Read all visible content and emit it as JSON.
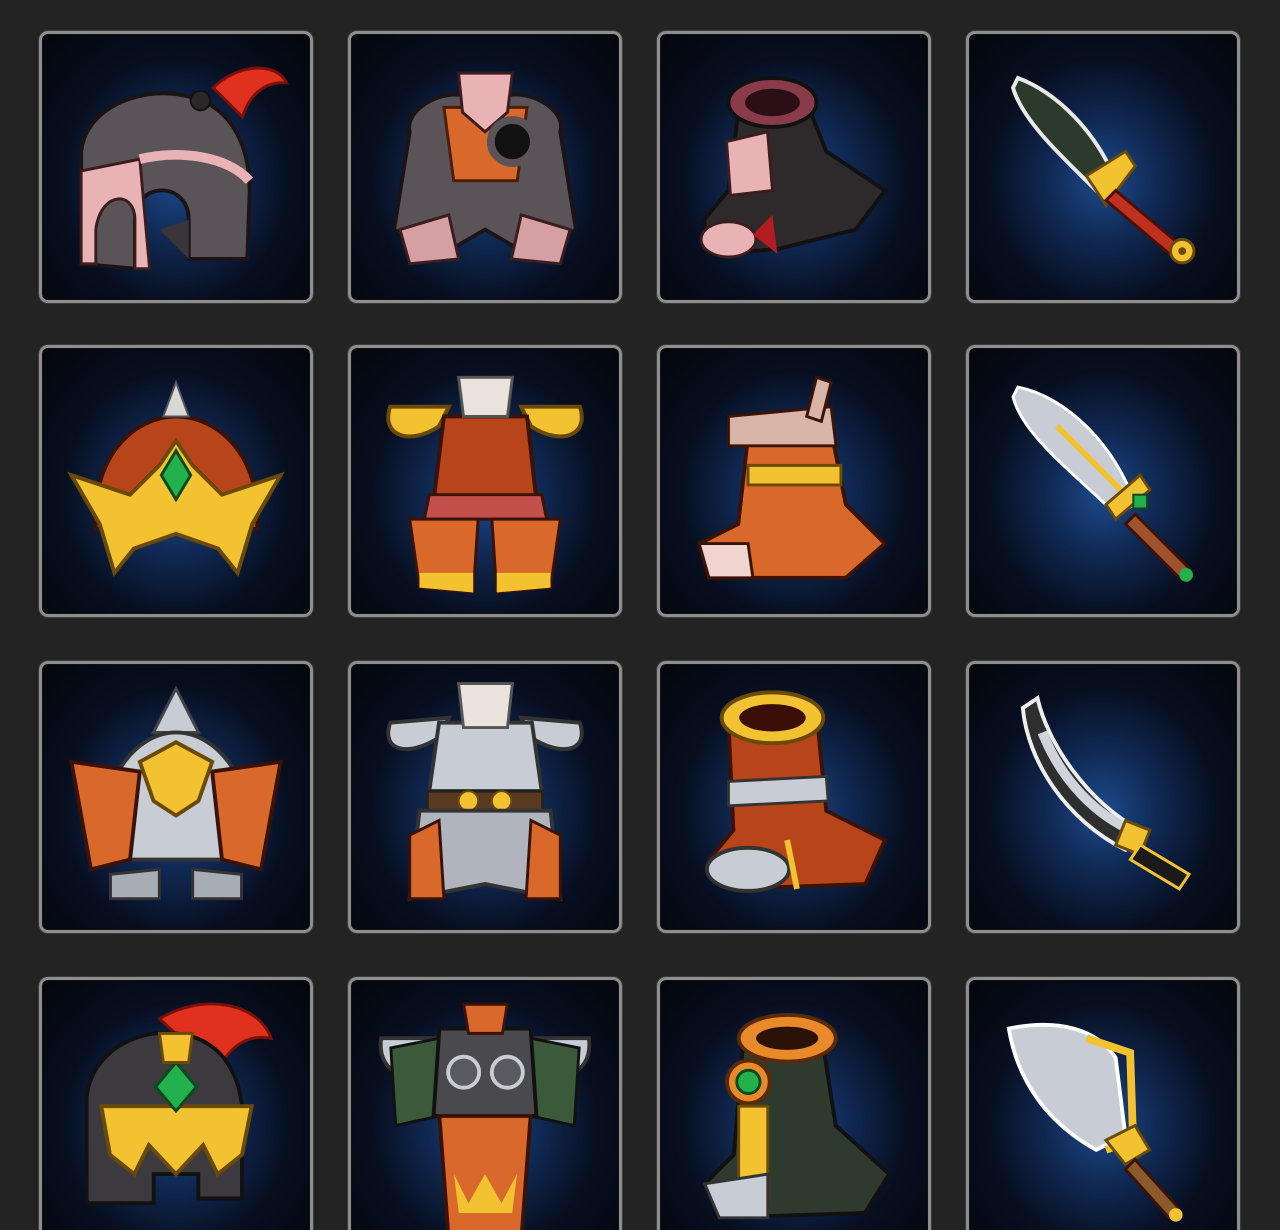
{
  "inventory": {
    "rows": 4,
    "columns": 4,
    "slots": [
      {
        "icon": "iron-plumed-helmet-icon",
        "type": "helmet",
        "row": 1,
        "col": 1
      },
      {
        "icon": "iron-chest-armor-icon",
        "type": "armor",
        "row": 1,
        "col": 2
      },
      {
        "icon": "iron-boot-icon",
        "type": "boots",
        "row": 1,
        "col": 3
      },
      {
        "icon": "gold-hilt-dagger-icon",
        "type": "weapon",
        "row": 1,
        "col": 4
      },
      {
        "icon": "emerald-crown-helmet-icon",
        "type": "helmet",
        "row": 2,
        "col": 1
      },
      {
        "icon": "orange-horned-armor-icon",
        "type": "armor",
        "row": 2,
        "col": 2
      },
      {
        "icon": "wrapped-leather-boot-icon",
        "type": "boots",
        "row": 2,
        "col": 3
      },
      {
        "icon": "emerald-steel-sword-icon",
        "type": "weapon",
        "row": 2,
        "col": 4
      },
      {
        "icon": "eagle-crest-helmet-icon",
        "type": "helmet",
        "row": 3,
        "col": 1
      },
      {
        "icon": "silver-scale-armor-icon",
        "type": "armor",
        "row": 3,
        "col": 2
      },
      {
        "icon": "gold-rim-boot-icon",
        "type": "boots",
        "row": 3,
        "col": 3
      },
      {
        "icon": "curved-machete-icon",
        "type": "weapon",
        "row": 3,
        "col": 4
      },
      {
        "icon": "royal-plumed-helmet-icon",
        "type": "helmet",
        "row": 4,
        "col": 1
      },
      {
        "icon": "jade-demon-armor-icon",
        "type": "armor",
        "row": 4,
        "col": 2
      },
      {
        "icon": "jade-gem-boot-icon",
        "type": "boots",
        "row": 4,
        "col": 3
      },
      {
        "icon": "broad-cleaver-blade-icon",
        "type": "weapon",
        "row": 4,
        "col": 4
      }
    ],
    "colors": {
      "background": "#232323",
      "slot_border": "#8e8e8e",
      "slot_glow": "#1d4a8c",
      "gold": "#f2c230",
      "orange": "#d9692a",
      "iron": "#5a5458",
      "emerald": "#22b14c",
      "plume_red": "#e0301e"
    }
  }
}
